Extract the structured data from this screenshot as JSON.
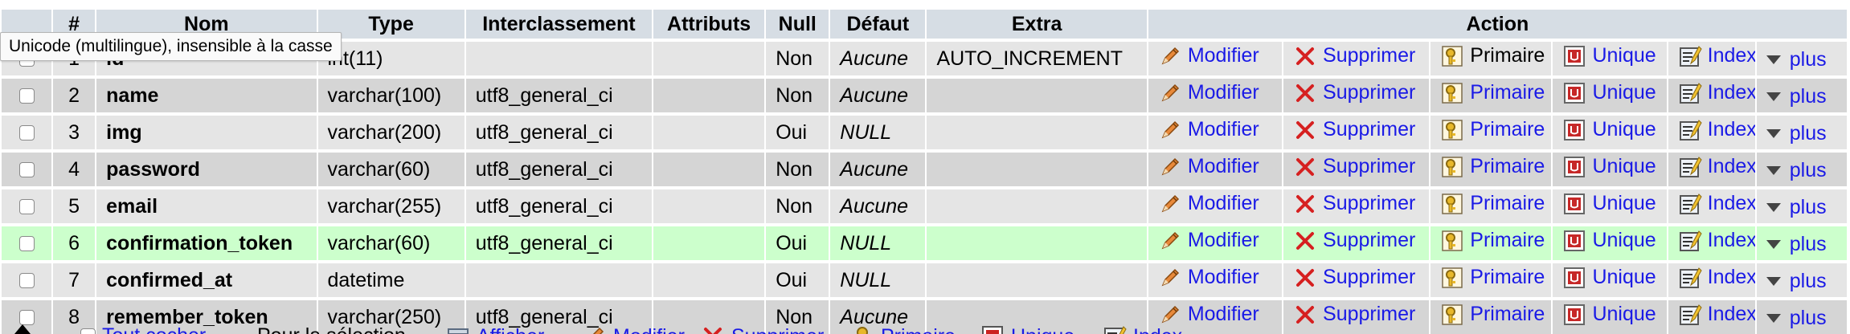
{
  "columns": {
    "num": "#",
    "name": "Nom",
    "type": "Type",
    "collation": "Interclassement",
    "attributes": "Attributs",
    "null": "Null",
    "default": "Défaut",
    "extra": "Extra",
    "action": "Action"
  },
  "tooltip": "Unicode (multilingue), insensible à la casse",
  "actions": {
    "modify": "Modifier",
    "delete": "Supprimer",
    "primary": "Primaire",
    "unique": "Unique",
    "index": "Index",
    "more": "plus"
  },
  "action_icons": {
    "modify": "pencil-icon",
    "delete": "delete-x-icon",
    "primary": "primary-key-icon",
    "unique": "unique-icon",
    "index": "index-icon",
    "more": "dropdown-arrow-icon"
  },
  "highlight_row": 6,
  "rows": [
    {
      "num": "1",
      "name": "id",
      "type": "int(11)",
      "collation": "",
      "attributes": "",
      "null": "Non",
      "default": "Aucune",
      "extra": "AUTO_INCREMENT",
      "primary_disabled": true
    },
    {
      "num": "2",
      "name": "name",
      "type": "varchar(100)",
      "collation": "utf8_general_ci",
      "attributes": "",
      "null": "Non",
      "default": "Aucune",
      "extra": ""
    },
    {
      "num": "3",
      "name": "img",
      "type": "varchar(200)",
      "collation": "utf8_general_ci",
      "attributes": "",
      "null": "Oui",
      "default": "NULL",
      "extra": ""
    },
    {
      "num": "4",
      "name": "password",
      "type": "varchar(60)",
      "collation": "utf8_general_ci",
      "attributes": "",
      "null": "Non",
      "default": "Aucune",
      "extra": ""
    },
    {
      "num": "5",
      "name": "email",
      "type": "varchar(255)",
      "collation": "utf8_general_ci",
      "attributes": "",
      "null": "Non",
      "default": "Aucune",
      "extra": ""
    },
    {
      "num": "6",
      "name": "confirmation_token",
      "type": "varchar(60)",
      "collation": "utf8_general_ci",
      "attributes": "",
      "null": "Oui",
      "default": "NULL",
      "extra": ""
    },
    {
      "num": "7",
      "name": "confirmed_at",
      "type": "datetime",
      "collation": "",
      "attributes": "",
      "null": "Oui",
      "default": "NULL",
      "extra": ""
    },
    {
      "num": "8",
      "name": "remember_token",
      "type": "varchar(250)",
      "collation": "utf8_general_ci",
      "attributes": "",
      "null": "Non",
      "default": "Aucune",
      "extra": ""
    }
  ],
  "bottom_bar": {
    "check_all": "Tout cocher",
    "for_selection": "Pour la sélection",
    "browse": "Afficher",
    "modify": "Modifier",
    "delete": "Supprimer",
    "primary": "Primaire",
    "unique": "Unique",
    "index": "Index"
  }
}
